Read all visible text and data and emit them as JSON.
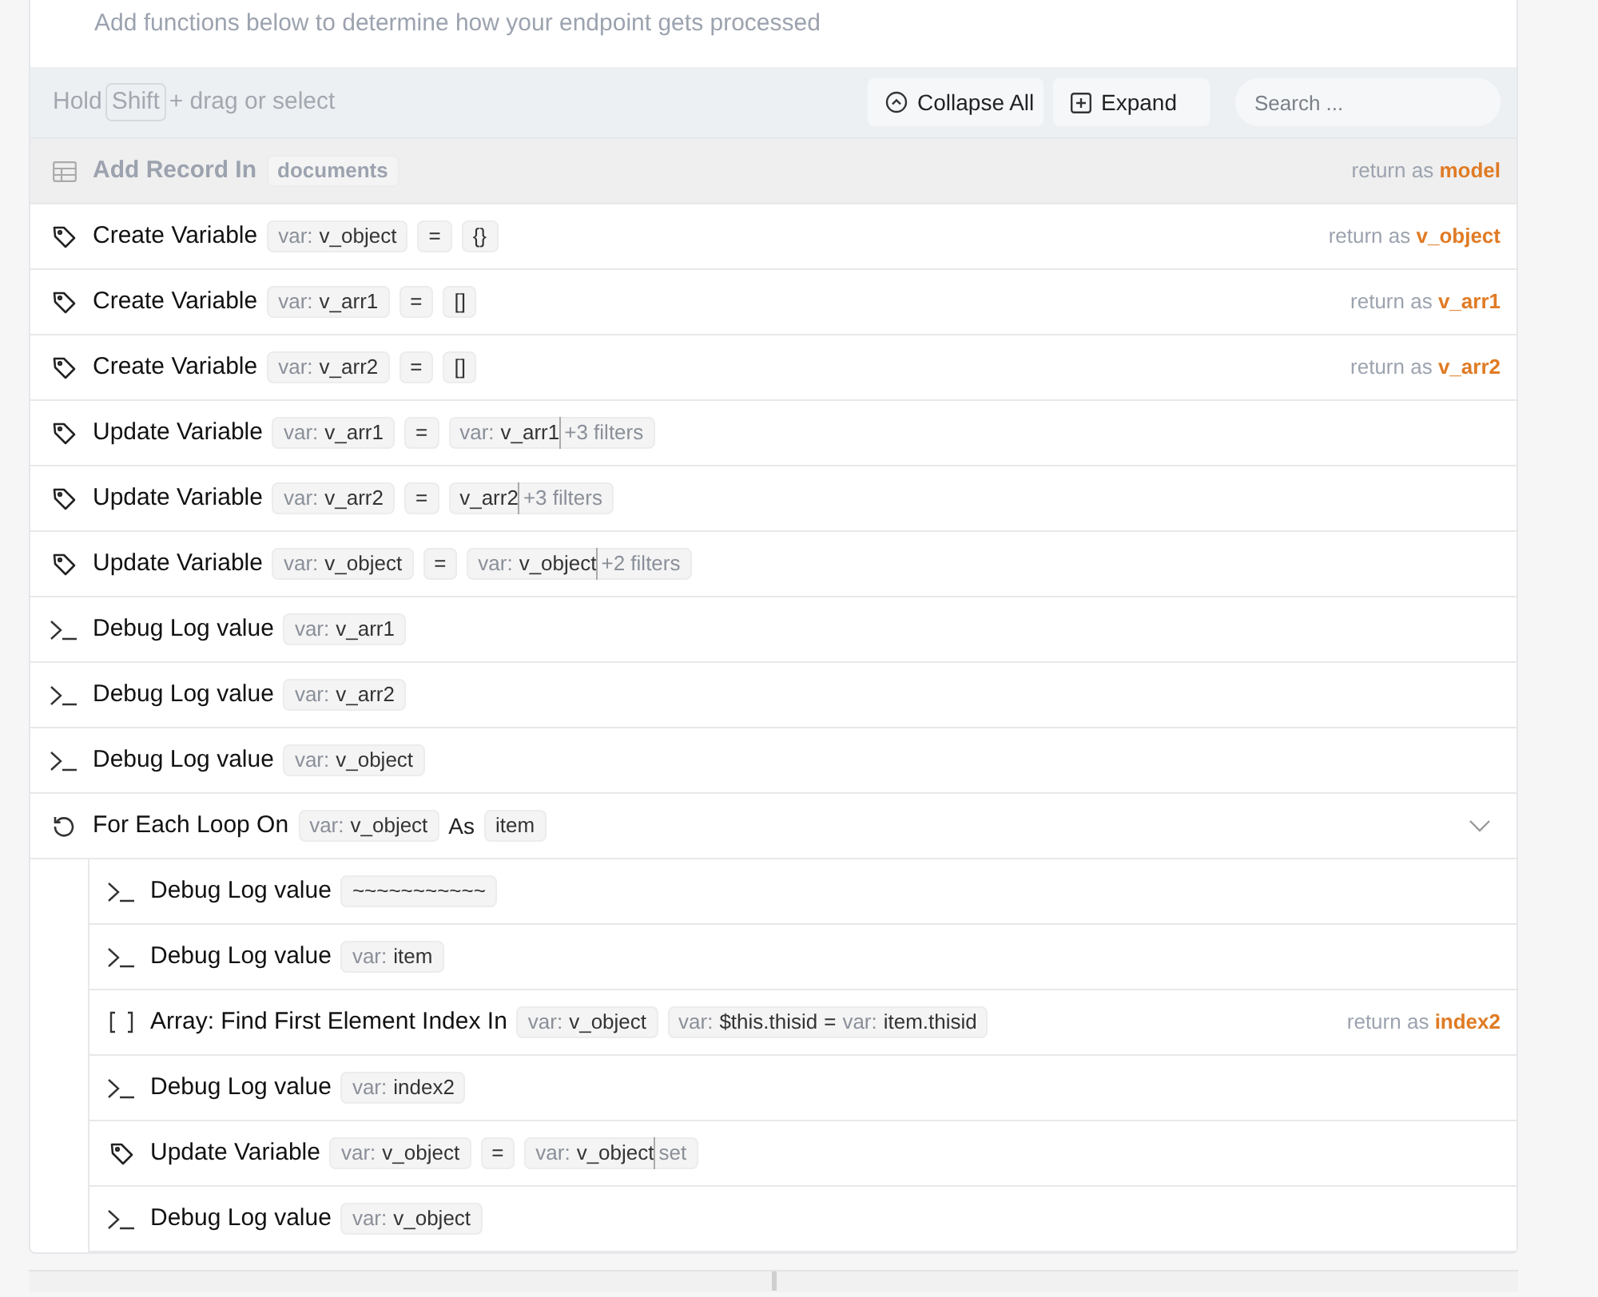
{
  "description": "Add functions below to determine how your endpoint gets processed",
  "toolbar": {
    "hint_before": "Hold",
    "hint_key": "Shift",
    "hint_after": "+ drag or select",
    "buttons": [
      {
        "kind": "collapse",
        "label": "Collapse All"
      },
      {
        "kind": "expand",
        "label": "Expand"
      }
    ],
    "search": {
      "placeholder": "Search ..."
    }
  },
  "steps": [
    {
      "kind": "table",
      "title": "Add Record In",
      "disabled": true,
      "tokens": [
        {
          "kind": "chip",
          "parts": [
            {
              "text": "documents",
              "muted": false
            }
          ]
        }
      ],
      "return_as": {
        "label": "return as",
        "value": "model"
      }
    },
    {
      "kind": "tag",
      "title": "Create Variable",
      "disabled": false,
      "tokens": [
        {
          "kind": "chip",
          "parts": [
            {
              "text": "var:",
              "muted": true
            },
            {
              "text": "v_object",
              "muted": false
            }
          ]
        },
        {
          "kind": "chip",
          "parts": [
            {
              "text": "=",
              "muted": false
            }
          ]
        },
        {
          "kind": "chip",
          "parts": [
            {
              "text": "{}",
              "muted": false
            }
          ]
        }
      ],
      "return_as": {
        "label": "return as",
        "value": "v_object"
      }
    },
    {
      "kind": "tag",
      "title": "Create Variable",
      "disabled": false,
      "tokens": [
        {
          "kind": "chip",
          "parts": [
            {
              "text": "var:",
              "muted": true
            },
            {
              "text": "v_arr1",
              "muted": false
            }
          ]
        },
        {
          "kind": "chip",
          "parts": [
            {
              "text": "=",
              "muted": false
            }
          ]
        },
        {
          "kind": "chip",
          "parts": [
            {
              "text": "[]",
              "muted": false
            }
          ]
        }
      ],
      "return_as": {
        "label": "return as",
        "value": "v_arr1"
      }
    },
    {
      "kind": "tag",
      "title": "Create Variable",
      "disabled": false,
      "tokens": [
        {
          "kind": "chip",
          "parts": [
            {
              "text": "var:",
              "muted": true
            },
            {
              "text": "v_arr2",
              "muted": false
            }
          ]
        },
        {
          "kind": "chip",
          "parts": [
            {
              "text": "=",
              "muted": false
            }
          ]
        },
        {
          "kind": "chip",
          "parts": [
            {
              "text": "[]",
              "muted": false
            }
          ]
        }
      ],
      "return_as": {
        "label": "return as",
        "value": "v_arr2"
      }
    },
    {
      "kind": "tag",
      "title": "Update Variable",
      "disabled": false,
      "tokens": [
        {
          "kind": "chip",
          "parts": [
            {
              "text": "var:",
              "muted": true
            },
            {
              "text": "v_arr1",
              "muted": false
            }
          ]
        },
        {
          "kind": "chip",
          "parts": [
            {
              "text": "=",
              "muted": false
            }
          ]
        },
        {
          "kind": "chip",
          "parts": [
            {
              "text": "var:",
              "muted": true
            },
            {
              "text": "v_arr1",
              "muted": false
            }
          ],
          "suffix": "+3 filters"
        }
      ]
    },
    {
      "kind": "tag",
      "title": "Update Variable",
      "disabled": false,
      "tokens": [
        {
          "kind": "chip",
          "parts": [
            {
              "text": "var:",
              "muted": true
            },
            {
              "text": "v_arr2",
              "muted": false
            }
          ]
        },
        {
          "kind": "chip",
          "parts": [
            {
              "text": "=",
              "muted": false
            }
          ]
        },
        {
          "kind": "chip",
          "parts": [
            {
              "text": "v_arr2",
              "muted": false
            }
          ],
          "suffix": "+3 filters"
        }
      ]
    },
    {
      "kind": "tag",
      "title": "Update Variable",
      "disabled": false,
      "tokens": [
        {
          "kind": "chip",
          "parts": [
            {
              "text": "var:",
              "muted": true
            },
            {
              "text": "v_object",
              "muted": false
            }
          ]
        },
        {
          "kind": "chip",
          "parts": [
            {
              "text": "=",
              "muted": false
            }
          ]
        },
        {
          "kind": "chip",
          "parts": [
            {
              "text": "var:",
              "muted": true
            },
            {
              "text": "v_object",
              "muted": false
            }
          ],
          "suffix": "+2 filters"
        }
      ]
    },
    {
      "kind": "debug",
      "title": "Debug Log value",
      "disabled": false,
      "tokens": [
        {
          "kind": "chip",
          "parts": [
            {
              "text": "var:",
              "muted": true
            },
            {
              "text": "v_arr1",
              "muted": false
            }
          ]
        }
      ]
    },
    {
      "kind": "debug",
      "title": "Debug Log value",
      "disabled": false,
      "tokens": [
        {
          "kind": "chip",
          "parts": [
            {
              "text": "var:",
              "muted": true
            },
            {
              "text": "v_arr2",
              "muted": false
            }
          ]
        }
      ]
    },
    {
      "kind": "debug",
      "title": "Debug Log value",
      "disabled": false,
      "tokens": [
        {
          "kind": "chip",
          "parts": [
            {
              "text": "var:",
              "muted": true
            },
            {
              "text": "v_object",
              "muted": false
            }
          ]
        }
      ]
    },
    {
      "kind": "loop",
      "title": "For Each Loop On",
      "disabled": false,
      "expanded": true,
      "tokens": [
        {
          "kind": "chip",
          "parts": [
            {
              "text": "var:",
              "muted": true
            },
            {
              "text": "v_object",
              "muted": false
            }
          ]
        },
        {
          "kind": "word",
          "text": "As"
        },
        {
          "kind": "chip",
          "parts": [
            {
              "text": "item",
              "muted": false
            }
          ]
        }
      ],
      "children": [
        {
          "kind": "debug",
          "title": "Debug Log value",
          "disabled": false,
          "tokens": [
            {
              "kind": "chip",
              "parts": [
                {
                  "text": "~~~~~~~~~~~",
                  "muted": false
                }
              ]
            }
          ]
        },
        {
          "kind": "debug",
          "title": "Debug Log value",
          "disabled": false,
          "tokens": [
            {
              "kind": "chip",
              "parts": [
                {
                  "text": "var:",
                  "muted": true
                },
                {
                  "text": "item",
                  "muted": false
                }
              ]
            }
          ]
        },
        {
          "kind": "array",
          "title": "Array: Find First Element Index In",
          "disabled": false,
          "tokens": [
            {
              "kind": "chip",
              "parts": [
                {
                  "text": "var:",
                  "muted": true
                },
                {
                  "text": "v_object",
                  "muted": false
                }
              ]
            },
            {
              "kind": "chip",
              "parts": [
                {
                  "text": "var:",
                  "muted": true
                },
                {
                  "text": "$this.thisid",
                  "muted": false
                },
                {
                  "text": "=",
                  "muted": false
                },
                {
                  "text": "var:",
                  "muted": true
                },
                {
                  "text": "item.thisid",
                  "muted": false
                }
              ]
            }
          ],
          "return_as": {
            "label": "return as",
            "value": "index2"
          }
        },
        {
          "kind": "debug",
          "title": "Debug Log value",
          "disabled": false,
          "tokens": [
            {
              "kind": "chip",
              "parts": [
                {
                  "text": "var:",
                  "muted": true
                },
                {
                  "text": "index2",
                  "muted": false
                }
              ]
            }
          ]
        },
        {
          "kind": "tag",
          "title": "Update Variable",
          "disabled": false,
          "tokens": [
            {
              "kind": "chip",
              "parts": [
                {
                  "text": "var:",
                  "muted": true
                },
                {
                  "text": "v_object",
                  "muted": false
                }
              ]
            },
            {
              "kind": "chip",
              "parts": [
                {
                  "text": "=",
                  "muted": false
                }
              ]
            },
            {
              "kind": "chip",
              "parts": [
                {
                  "text": "var:",
                  "muted": true
                },
                {
                  "text": "v_object",
                  "muted": false
                }
              ],
              "suffix": "set"
            }
          ]
        },
        {
          "kind": "debug",
          "title": "Debug Log value",
          "disabled": false,
          "tokens": [
            {
              "kind": "chip",
              "parts": [
                {
                  "text": "var:",
                  "muted": true
                },
                {
                  "text": "v_object",
                  "muted": false
                }
              ]
            }
          ]
        }
      ]
    }
  ]
}
